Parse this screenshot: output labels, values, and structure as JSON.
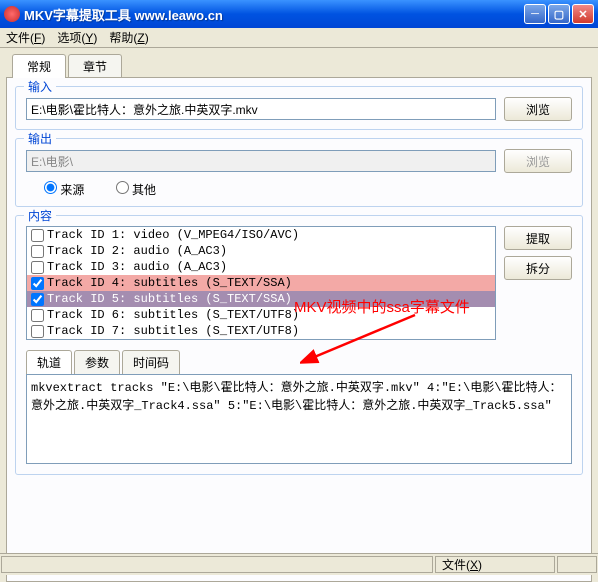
{
  "titlebar": {
    "text": "MKV字幕提取工具   www.leawo.cn"
  },
  "menu": {
    "file": "文件(F)",
    "file_u": "F",
    "file_pre": "文件(",
    "options": "选项(Y)",
    "options_u": "Y",
    "options_pre": "选项(",
    "help": "帮助(Z)",
    "help_u": "Z",
    "help_pre": "帮助(",
    "suf": ")"
  },
  "tabs": {
    "general": "常规",
    "chapters": "章节"
  },
  "input": {
    "label": "输入",
    "path": "E:\\电影\\霍比特人：意外之旅.中英双字.mkv",
    "browse": "浏览"
  },
  "output": {
    "label": "输出",
    "path": "E:\\电影\\",
    "browse": "浏览",
    "radio_source": "来源",
    "radio_other": "其他"
  },
  "content": {
    "label": "内容",
    "extract": "提取",
    "split": "拆分",
    "tracks": [
      {
        "text": "Track ID 1: video (V_MPEG4/ISO/AVC)",
        "checked": false,
        "sel": ""
      },
      {
        "text": "Track ID 2: audio (A_AC3)",
        "checked": false,
        "sel": ""
      },
      {
        "text": "Track ID 3: audio (A_AC3)",
        "checked": false,
        "sel": ""
      },
      {
        "text": "Track ID 4: subtitles (S_TEXT/SSA)",
        "checked": true,
        "sel": "sel1"
      },
      {
        "text": "Track ID 5: subtitles (S_TEXT/SSA)",
        "checked": true,
        "sel": "sel2"
      },
      {
        "text": "Track ID 6: subtitles (S_TEXT/UTF8)",
        "checked": false,
        "sel": ""
      },
      {
        "text": "Track ID 7: subtitles (S_TEXT/UTF8)",
        "checked": false,
        "sel": ""
      }
    ],
    "inner_tabs": {
      "track": "轨道",
      "params": "参数",
      "timecode": "时间码"
    },
    "cmd": "mkvextract tracks \"E:\\电影\\霍比特人：意外之旅.中英双字.mkv\" 4:\"E:\\电影\\霍比特人：意外之旅.中英双字_Track4.ssa\" 5:\"E:\\电影\\霍比特人：意外之旅.中英双字_Track5.ssa\""
  },
  "status": {
    "file": "文件(X)",
    "file_pre": "文件(",
    "file_u": "X",
    "suf": ")"
  },
  "annotation": "MKV视频中的ssa字幕文件"
}
